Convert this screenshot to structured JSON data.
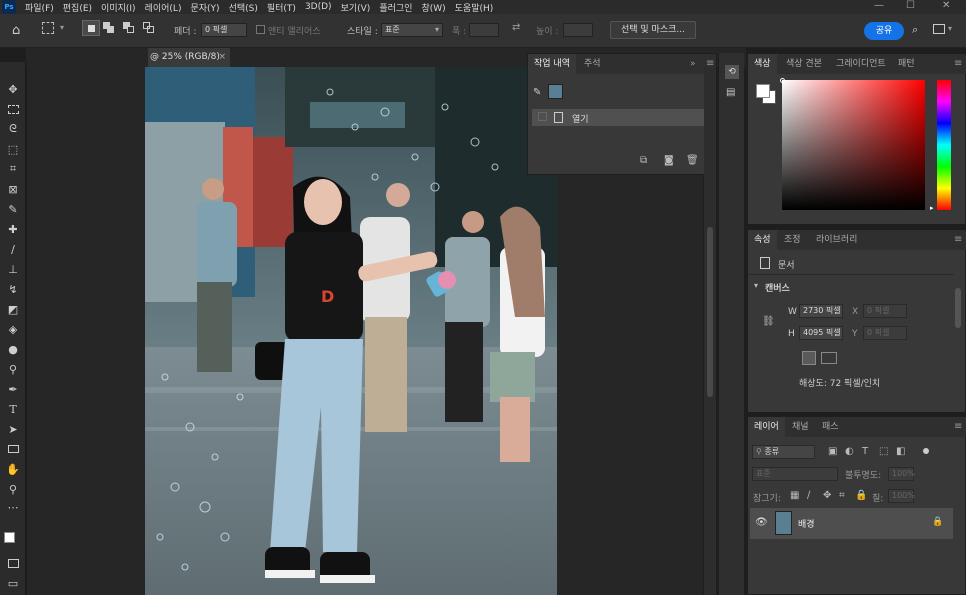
{
  "menubar": {
    "logo": "Ps",
    "items": [
      "파일(F)",
      "편집(E)",
      "이미지(I)",
      "레이어(L)",
      "문자(Y)",
      "선택(S)",
      "필터(T)",
      "3D(D)",
      "보기(V)",
      "플러그인",
      "창(W)",
      "도움말(H)"
    ]
  },
  "options": {
    "feather_label": "페더 :",
    "feather_value": "0 픽셀",
    "antialias_label": "앤티 앨리어스",
    "style_label": "스타일 :",
    "style_value": "표준",
    "width_label": "폭 :",
    "height_label": "높이 :",
    "select_mask_button": "선택 및 마스크...",
    "share_button": "공유"
  },
  "document": {
    "tab_title": "@ 25% (RGB/8)",
    "tab_close": "×"
  },
  "history_panel": {
    "tabs": [
      "작업 내역",
      "주석"
    ],
    "open_state": "열기"
  },
  "color_panel": {
    "tabs": [
      "색상",
      "색상 견본",
      "그레이디언트",
      "패턴"
    ]
  },
  "properties_panel": {
    "tabs": [
      "속성",
      "조정",
      "라이브러리"
    ],
    "doc_label": "문서",
    "canvas_label": "캔버스",
    "w_label": "W",
    "w_value": "2730 픽셀",
    "h_label": "H",
    "h_value": "4095 픽셀",
    "x_label": "X",
    "x_value": "0 픽셀",
    "y_label": "Y",
    "y_value": "0 픽셀",
    "resolution": "해상도: 72 픽셀/인치"
  },
  "layers_panel": {
    "tabs": [
      "레이어",
      "채널",
      "패스"
    ],
    "filter_kind": "종류",
    "blend_mode": "표준",
    "opacity_label": "불투명도:",
    "opacity_value": "100%",
    "lock_label": "잠그기:",
    "fill_label": "칠:",
    "fill_value": "100%",
    "layer_name": "배경"
  },
  "colors": {
    "accent": "#1473e6",
    "panel_bg": "#383838",
    "app_bg": "#1e1e1e"
  }
}
